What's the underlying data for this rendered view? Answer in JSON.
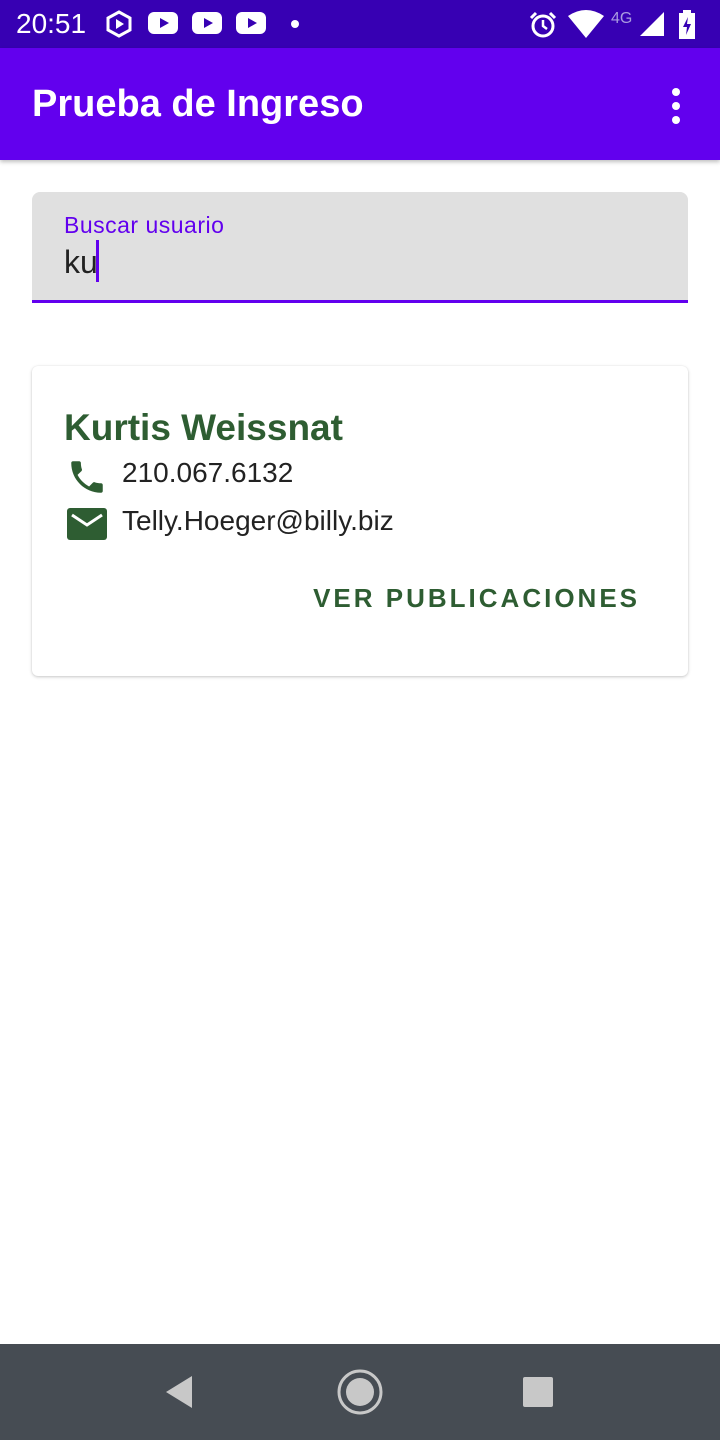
{
  "status_bar": {
    "time": "20:51",
    "network_label": "4G",
    "icons": [
      "hexagon-play-icon",
      "youtube-icon",
      "youtube-icon",
      "youtube-icon",
      "notification-dot-icon",
      "alarm-icon",
      "wifi-icon",
      "signal-icon",
      "battery-icon"
    ]
  },
  "app_bar": {
    "title": "Prueba de Ingreso",
    "overflow_icon": "more-vert-icon"
  },
  "search": {
    "label": "Buscar usuario",
    "value": "ku",
    "placeholder": ""
  },
  "users": [
    {
      "name": "Kurtis Weissnat",
      "phone": "210.067.6132",
      "email": "Telly.Hoeger@billy.biz",
      "action_label": "VER PUBLICACIONES"
    }
  ],
  "nav_bar": {
    "icons": [
      "back-icon",
      "home-icon",
      "recents-icon"
    ]
  },
  "colors": {
    "status_bar": "#3700b3",
    "app_bar": "#6200ee",
    "accent": "#6200ee",
    "card_text": "#2e5d32",
    "nav_bar": "#464c53"
  }
}
